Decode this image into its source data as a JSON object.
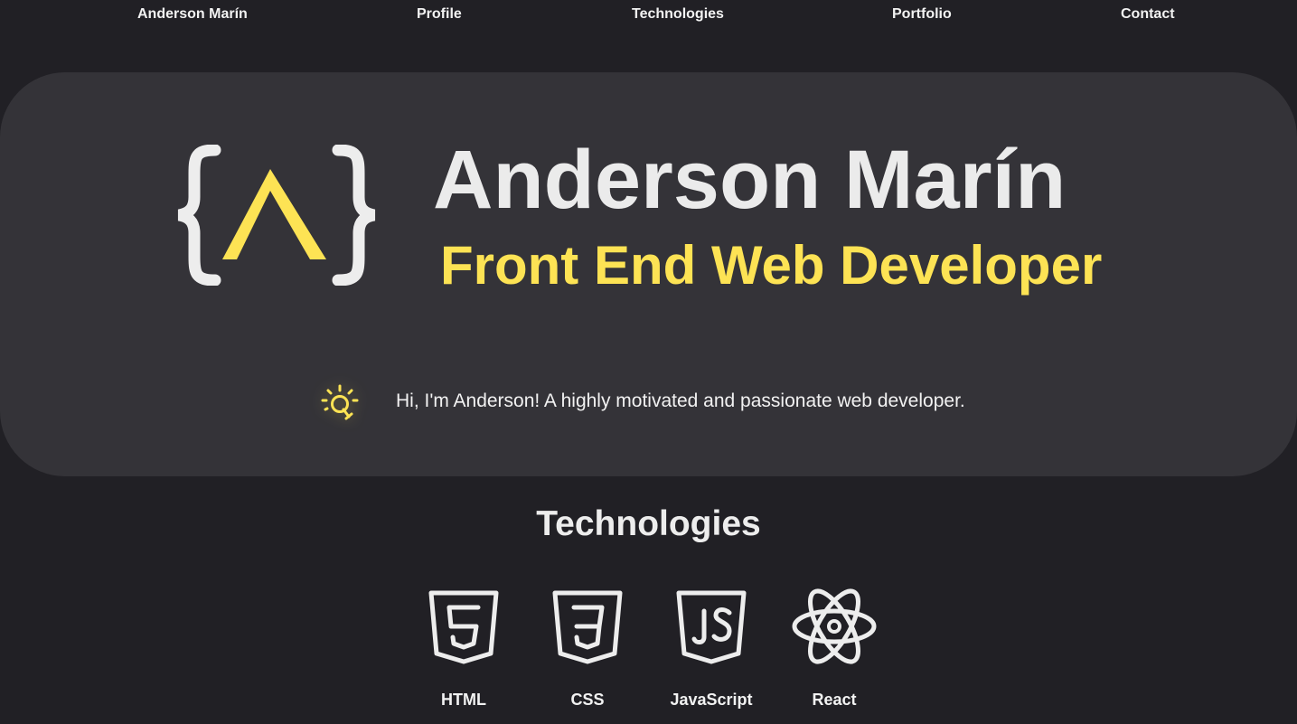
{
  "nav": {
    "brand": "Anderson Marín",
    "items": [
      {
        "label": "Profile"
      },
      {
        "label": "Technologies"
      },
      {
        "label": "Portfolio"
      },
      {
        "label": "Contact"
      }
    ]
  },
  "hero": {
    "logo_icon": "curly-braces-caret-logo",
    "name": "Anderson Marín",
    "role": "Front End Web Developer",
    "intro_icon": "lightbulb-icon",
    "intro": "Hi, I'm Anderson! A highly motivated and passionate web developer."
  },
  "technologies": {
    "title": "Technologies",
    "items": [
      {
        "label": "HTML",
        "icon": "html5-icon"
      },
      {
        "label": "CSS",
        "icon": "css3-icon"
      },
      {
        "label": "JavaScript",
        "icon": "javascript-icon"
      },
      {
        "label": "React",
        "icon": "react-icon"
      }
    ]
  },
  "colors": {
    "background": "#212025",
    "panel": "#343338",
    "accent": "#fde354",
    "text": "#ededed"
  }
}
